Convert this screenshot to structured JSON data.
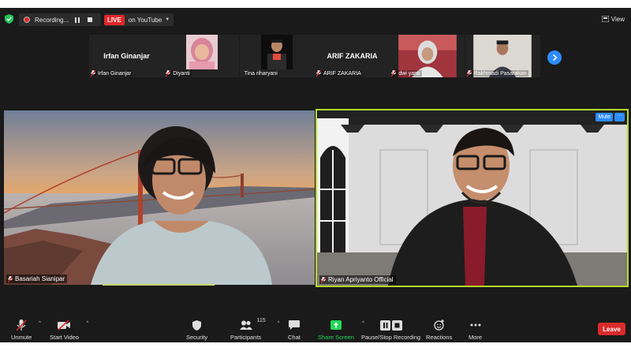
{
  "topbar": {
    "recording_label": "Recording...",
    "live_label": "LIVE",
    "live_target": "on YouTube",
    "view_label": "View"
  },
  "participants": [
    {
      "name": "Irfan Ginanjar",
      "display": "Irfan Ginanjar",
      "type": "name"
    },
    {
      "name": "Diyanti",
      "type": "photo"
    },
    {
      "name": "Tina riharyani",
      "type": "photo"
    },
    {
      "name": "ARIF ZAKARIA",
      "display": "ARIF ZAKARIA",
      "type": "name"
    },
    {
      "name": "dwi yanti",
      "type": "photo"
    },
    {
      "name": "Rakhmadi Pasarakan",
      "type": "photo"
    }
  ],
  "videos": {
    "left": {
      "name": "Basariah Sianipar"
    },
    "right": {
      "name": "Riyan Apriyanto Official",
      "mute_label": "Mute",
      "more_label": "···"
    }
  },
  "toolbar": {
    "unmute": "Unmute",
    "start_video": "Start Video",
    "security": "Security",
    "participants": "Participants",
    "participants_count": "115",
    "chat": "Chat",
    "share_screen": "Share Screen",
    "pause_recording": "Pause/Stop Recording",
    "reactions": "Reactions",
    "more": "More",
    "leave": "Leave"
  },
  "colors": {
    "accent_blue": "#2d8cff",
    "live_red": "#e0272a",
    "leave_red": "#d92b2b",
    "active_speaker": "#b6d82c",
    "share_green": "#23d959"
  }
}
